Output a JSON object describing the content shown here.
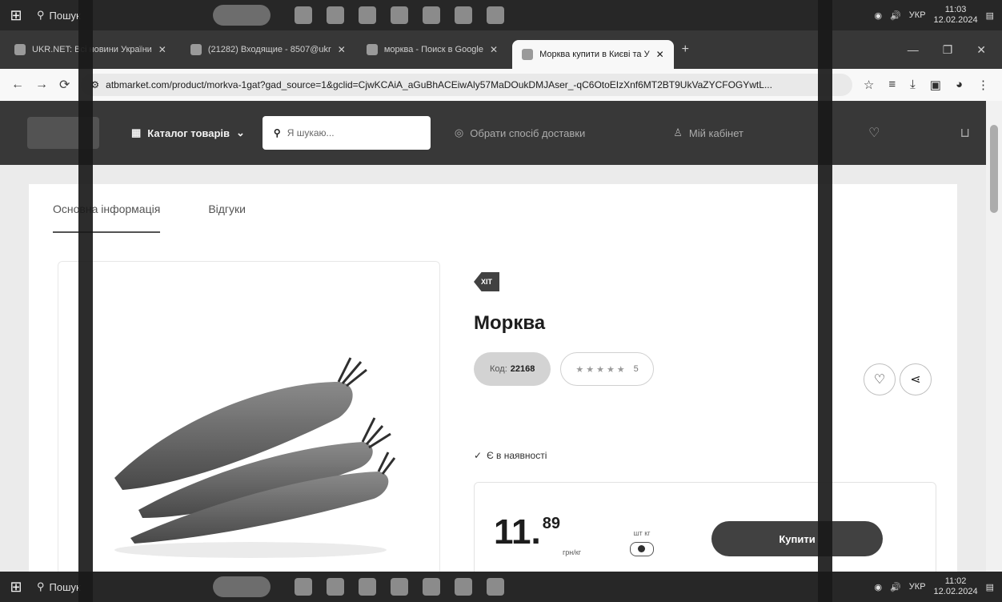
{
  "taskbar_top": {
    "search_label": "Пошук",
    "lang": "УКР",
    "time": "11:03",
    "date": "12.02.2024"
  },
  "taskbar_bottom": {
    "search_label": "Пошук",
    "lang": "УКР",
    "time": "11:02",
    "date": "12.02.2024"
  },
  "tabs": [
    {
      "label": "UKR.NET: Всі новини України"
    },
    {
      "label": "(21282) Входящие - 8507@ukr"
    },
    {
      "label": "морква - Поиск в Google"
    },
    {
      "label": "Морква купити в Києві та У",
      "active": true
    }
  ],
  "address": {
    "url": "atbmarket.com/product/morkva-1gat?gad_source=1&gclid=CjwKCAiA_aGuBhACEiwAly57MaDOukDMJAser_-qC6OtoEIzXnf6MT2BT9UkVaZYCFOGYwtL..."
  },
  "header": {
    "catalog_label": "Каталог товарів",
    "search_placeholder": "Я шукаю...",
    "delivery_label": "Обрати спосіб доставки",
    "cabinet_label": "Мій кабінет"
  },
  "page_tabs": [
    {
      "label": "Основна інформація"
    },
    {
      "label": "Відгуки"
    }
  ],
  "product": {
    "badge": "ХІТ",
    "title": "Морква",
    "code_label": "Код:",
    "code_value": "22168",
    "rating_stars": "★★★★★",
    "rating_count": "5",
    "stock": "Є в наявності",
    "price_int": "11.",
    "price_dec": "89",
    "price_unit": "грн/кг",
    "unit_toggle_label": "шт кг",
    "buy_label": "Купити"
  }
}
